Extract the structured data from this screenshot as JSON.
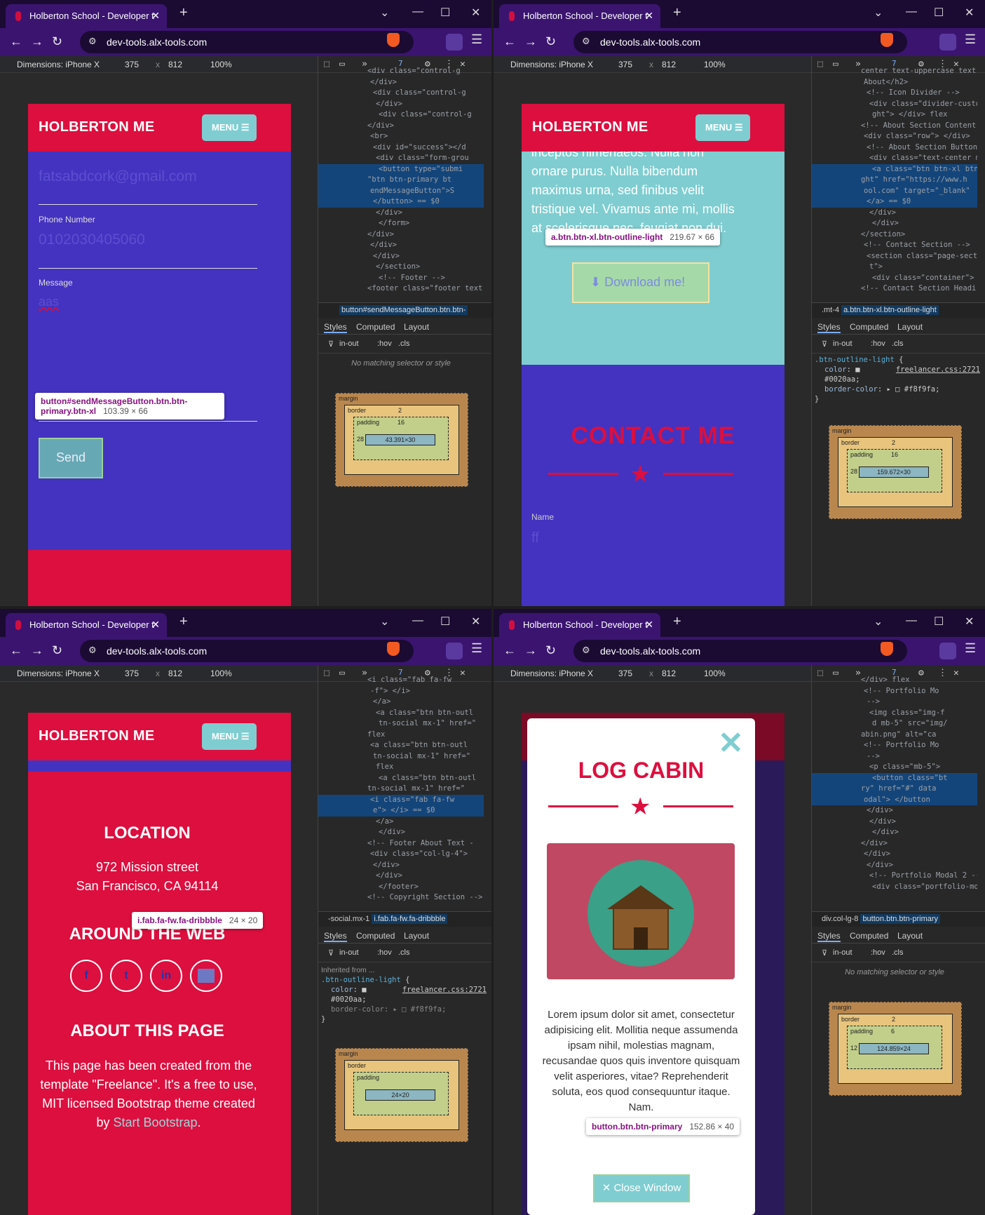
{
  "browser": {
    "tab_title": "Holberton School - Developer t",
    "url": "dev-tools.alx-tools.com",
    "dimensions_label": "Dimensions: iPhone X",
    "width": "375",
    "height": "812",
    "zoom": "100%",
    "issues_count": "7"
  },
  "site": {
    "brand": "HOLBERTON ME",
    "menu_label": "MENU"
  },
  "q0": {
    "email_value": "fatsabdcork@gmail.com",
    "phone_label": "Phone Number",
    "phone_value": "0102030405060",
    "message_label": "Message",
    "message_value": "aas",
    "send_label": "Send",
    "tooltip_selector": "button#sendMessageButton.btn.btn-primary.btn-xl",
    "tooltip_size": "103.39 × 66",
    "breadcrumb": "button#sendMessageButton.btn.btn-",
    "no_match": "No matching selector or style",
    "box": {
      "border": "2",
      "padding": "16",
      "content": "43.391×30",
      "side_pad": "28"
    },
    "code": [
      "<div class=\"control-g",
      "</div>",
      "<div class=\"control-g",
      "</div>",
      "<div class=\"control-g",
      "</div>",
      "<br>",
      "<div id=\"success\"></d",
      "<div class=\"form-grou",
      "<button type=\"submi",
      "\"btn btn-primary bt",
      "endMessageButton\">S",
      "</button> == $0",
      "</div>",
      "</form>",
      "</div>",
      "</div>",
      "</div>",
      "</section>",
      "<!-- Footer -->",
      "<footer class=\"footer text-cen"
    ]
  },
  "q1": {
    "about_text": "inceptos himenaeos. Nulla non ornare purus. Nulla bibendum maximus urna, sed finibus velit tristique vel. Vivamus ante mi, mollis at scelerisque nec, feugiat non dui.",
    "download_label": "Download me!",
    "contact_heading": "CONTACT ME",
    "name_label": "Name",
    "name_value": "ff",
    "tooltip_selector": "a.btn.btn-xl.btn-outline-light",
    "tooltip_size": "219.67 × 66",
    "breadcrumb_pre": ".mt-4",
    "breadcrumb": "a.btn.btn-xl.btn-outline-light",
    "rule_selector": ".btn-outline-light",
    "rule_file": "freelancer.css:2721",
    "rule_color": "#0020aa",
    "rule_border": "#f8f9fa",
    "box": {
      "border": "2",
      "padding": "16",
      "content": "159.672×30",
      "side_pad": "28"
    },
    "code": [
      "center text-uppercase text",
      "About</h2>",
      "<!-- Icon Divider -->",
      "<div class=\"divider-custom",
      "ght\"> </div> flex",
      "<!-- About Section Content",
      "<div class=\"row\"> </div>",
      "<!-- About Section Button",
      "<div class=\"text-center mt",
      "<a class=\"btn btn-xl btn",
      "ght\" href=\"https://www.h",
      "ool.com\" target=\"_blank\"",
      "</a> == $0",
      "</div>",
      "</div>",
      "</section>",
      "<!-- Contact Section -->",
      "<section class=\"page-section\"",
      "t\">",
      "<div class=\"container\">",
      "<!-- Contact Section Headi"
    ]
  },
  "q2": {
    "location_heading": "LOCATION",
    "address1": "972 Mission street",
    "address2": "San Francisco, CA 94114",
    "web_heading": "AROUND THE WEB",
    "social": [
      "f",
      "t",
      "in",
      "d"
    ],
    "about_heading": "ABOUT THIS PAGE",
    "about_text": "This page has been created from the template \"Freelance\". It's a free to use, MIT licensed Bootstrap theme created by ",
    "about_link": "Start Bootstrap",
    "tooltip_selector": "i.fab.fa-fw.fa-dribbble",
    "tooltip_size": "24 × 20",
    "breadcrumb_pre": "-social.mx-1",
    "breadcrumb": "i.fab.fa-fw.fa-dribbble",
    "inherited": "Inherited from ...",
    "rule_selector": ".btn-outline-light",
    "rule_file": "freelancer.css:2721",
    "rule_color": "#0020aa",
    "rule_border": "#f8f9fa",
    "box": {
      "content": "24×20"
    },
    "code": [
      "<i class=\"fab fa-fw",
      "-f\"> </i>",
      "</a>",
      "<a class=\"btn btn-outl",
      "tn-social mx-1\" href=\"",
      "flex",
      "<a class=\"btn btn-outl",
      "tn-social mx-1\" href=\"",
      "flex",
      "<a class=\"btn btn-outl",
      "tn-social mx-1\" href=\"",
      "<i class=\"fab fa-fw",
      "e\"> </i> == $0",
      "</a>",
      "</div>",
      "<!-- Footer About Text -",
      "<div class=\"col-lg-4\">",
      "</div>",
      "</div>",
      "</footer>",
      "<!-- Copyright Section -->"
    ]
  },
  "q3": {
    "modal_title": "LOG CABIN",
    "modal_text": "Lorem ipsum dolor sit amet, consectetur adipisicing elit. Mollitia neque assumenda ipsam nihil, molestias magnam, recusandae quos quis inventore quisquam velit asperiores, vitae? Reprehenderit soluta, eos quod consequuntur itaque. Nam.",
    "close_label": "Close Window",
    "tooltip_selector": "button.btn.btn-primary",
    "tooltip_size": "152.86 × 40",
    "breadcrumb_pre": "div.col-lg-8",
    "breadcrumb": "button.btn.btn-primary",
    "no_match": "No matching selector or style",
    "box": {
      "border": "2",
      "padding": "6",
      "content": "124.859×24",
      "side_pad": "12"
    },
    "code": [
      " </div> flex",
      "<!-- Portfolio Mo",
      "-->",
      "<img class=\"img-f",
      "d mb-5\" src=\"img/",
      "abin.png\" alt=\"ca",
      "<!-- Portfolio Mo",
      "-->",
      "<p class=\"mb-5\">",
      "<button class=\"bt",
      "ry\" href=\"#\" data",
      "odal\"> </button",
      "</div>",
      "</div>",
      "</div>",
      "</div>",
      "</div>",
      "</div>",
      "<!-- Portfolio Modal 2 -->",
      "<div class=\"portfolio-modal mo"
    ]
  },
  "devtools_tabs": {
    "styles": "Styles",
    "computed": "Computed",
    "layout": "Layout",
    "filter": ":hov",
    "cls": ".cls",
    "filter_text": "in-out"
  },
  "colors": {
    "accent_red": "#dc0f3f",
    "teal": "#7fcdd0",
    "purple": "#4433c0",
    "tab": "#3b1470",
    "frame": "#1b0b33"
  }
}
